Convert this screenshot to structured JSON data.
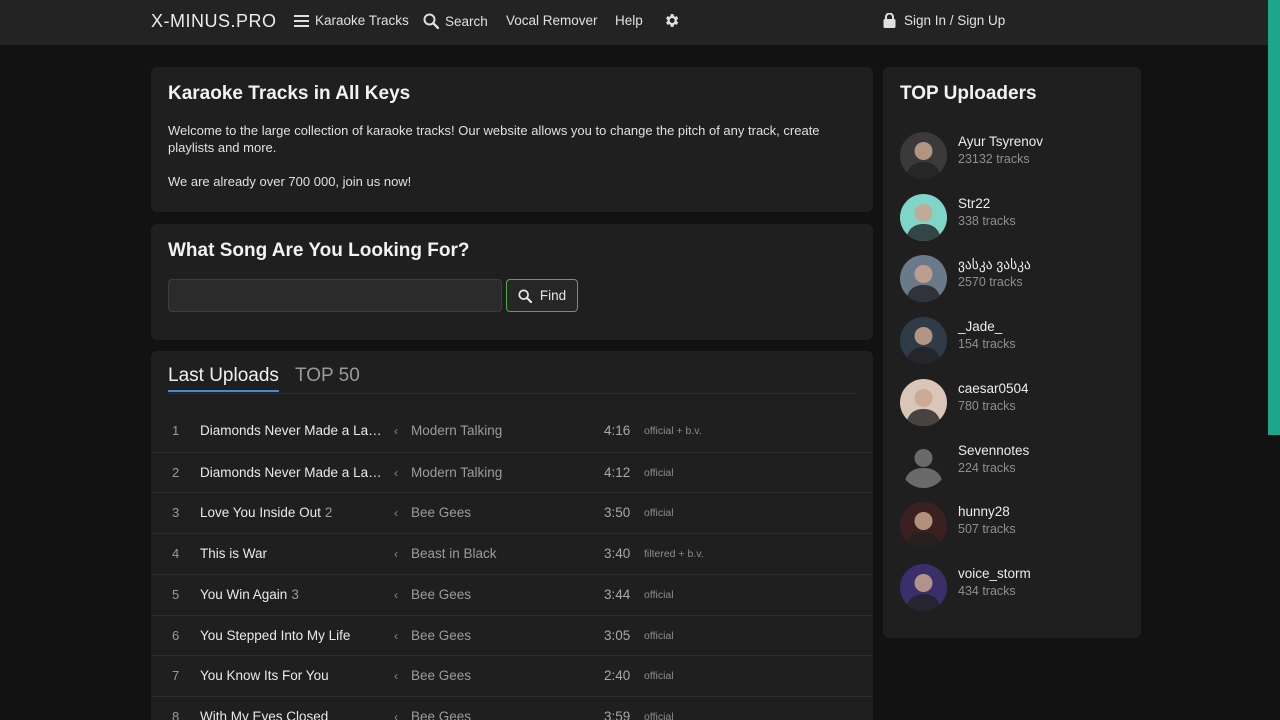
{
  "header": {
    "logo": "X-MINUS.PRO",
    "nav": {
      "karaoke_tracks": "Karaoke Tracks",
      "search": "Search",
      "vocal_remover": "Vocal Remover",
      "help": "Help"
    },
    "signin": "Sign In / Sign Up",
    "icons": [
      "menu-icon",
      "search-icon",
      "gear-icon",
      "lock-icon"
    ]
  },
  "intro": {
    "title": "Karaoke Tracks in All Keys",
    "text1": "Welcome to the large collection of karaoke tracks! Our website allows you to change the pitch of any track, create playlists and more.",
    "text2": "We are already over 700 000, join us now!"
  },
  "search": {
    "title": "What Song Are You Looking For?",
    "input_value": "",
    "placeholder": "",
    "button_label": "Find"
  },
  "tracks": {
    "tabs": [
      "Last Uploads",
      "TOP 50"
    ],
    "active_tab": "Last Uploads",
    "rows": [
      {
        "num": "1",
        "title": "Diamonds Never Made a Lad...",
        "count": "",
        "artist": "Modern Talking",
        "duration": "4:16",
        "type": "official + b.v."
      },
      {
        "num": "2",
        "title": "Diamonds Never Made a Lad...",
        "count": "",
        "artist": "Modern Talking",
        "duration": "4:12",
        "type": "official"
      },
      {
        "num": "3",
        "title": "Love You Inside Out",
        "count": "2",
        "artist": "Bee Gees",
        "duration": "3:50",
        "type": "official"
      },
      {
        "num": "4",
        "title": "This is War",
        "count": "",
        "artist": "Beast in Black",
        "duration": "3:40",
        "type": "filtered + b.v."
      },
      {
        "num": "5",
        "title": "You Win Again",
        "count": "3",
        "artist": "Bee Gees",
        "duration": "3:44",
        "type": "official"
      },
      {
        "num": "6",
        "title": "You Stepped Into My Life",
        "count": "",
        "artist": "Bee Gees",
        "duration": "3:05",
        "type": "official"
      },
      {
        "num": "7",
        "title": "You Know Its For You",
        "count": "",
        "artist": "Bee Gees",
        "duration": "2:40",
        "type": "official"
      },
      {
        "num": "8",
        "title": "With My Eyes Closed",
        "count": "",
        "artist": "Bee Gees",
        "duration": "3:59",
        "type": "official"
      }
    ]
  },
  "uploaders": {
    "title": "TOP Uploaders",
    "list": [
      {
        "name": "Ayur Tsyrenov",
        "tracks": "23132 tracks",
        "avatar_color": "#3a3a3a"
      },
      {
        "name": "Str22",
        "tracks": "338 tracks",
        "avatar_color": "#7fd6c8"
      },
      {
        "name": "ვასკა ვასკა",
        "tracks": "2570 tracks",
        "avatar_color": "#6b7a8a"
      },
      {
        "name": "_Jade_",
        "tracks": "154 tracks",
        "avatar_color": "#2f3b46"
      },
      {
        "name": "caesar0504",
        "tracks": "780 tracks",
        "avatar_color": "#d9c6b8"
      },
      {
        "name": "Sevennotes",
        "tracks": "224 tracks",
        "avatar_color": "#555555"
      },
      {
        "name": "hunny28",
        "tracks": "507 tracks",
        "avatar_color": "#3a2020"
      },
      {
        "name": "voice_storm",
        "tracks": "434 tracks",
        "avatar_color": "#3b2f6b"
      }
    ]
  },
  "colors": {
    "accent_green": "#4cae4c",
    "tab_underline": "#3b8ed8",
    "scroll_accent": "#1fa58c"
  }
}
